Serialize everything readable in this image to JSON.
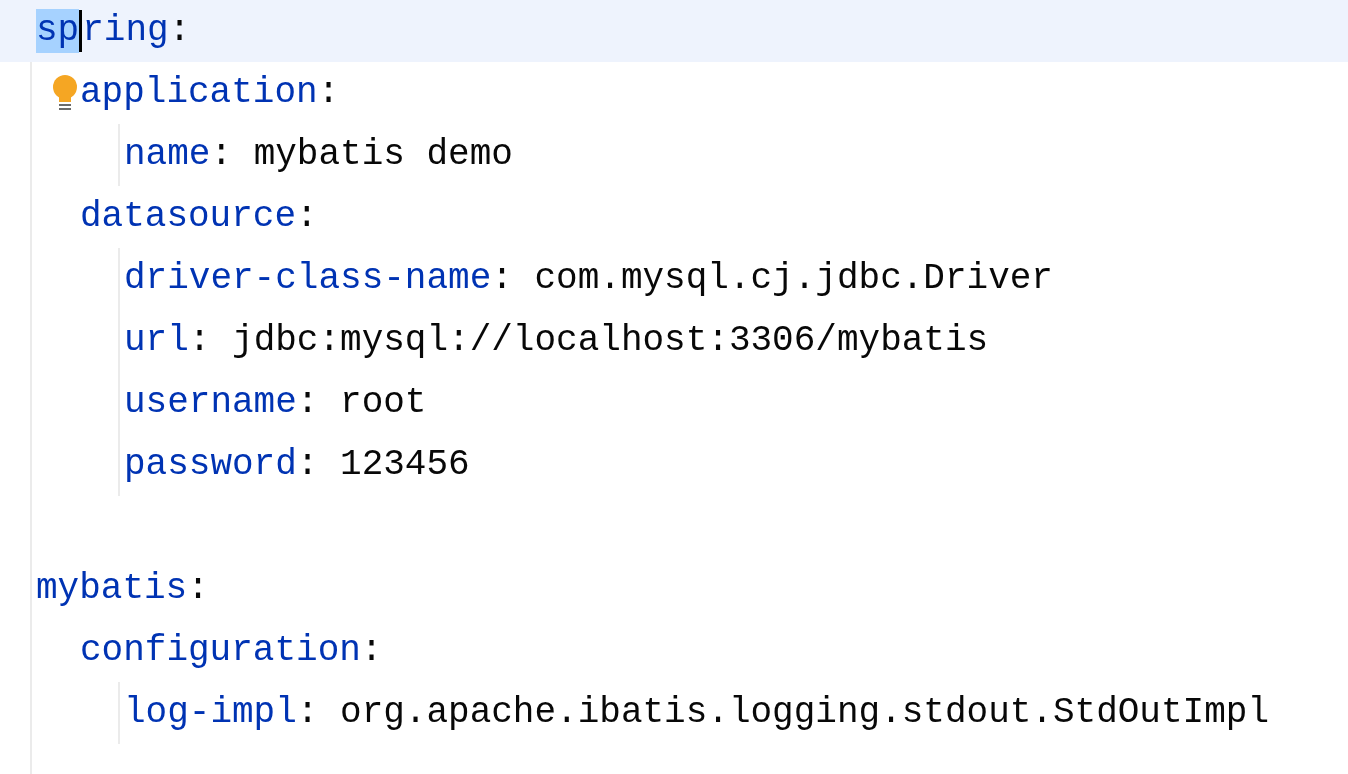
{
  "editor": {
    "lines": [
      {
        "kind": "entry",
        "current": true,
        "key_parts": [
          {
            "text": "sp",
            "selected": true
          },
          {
            "text": "ring",
            "selected": false
          }
        ],
        "colon": ":",
        "children": [
          {
            "kind": "entry",
            "hint": true,
            "key_parts": [
              {
                "text": "application",
                "selected": false
              }
            ],
            "colon": ":",
            "children": [
              {
                "kind": "entry",
                "key_parts": [
                  {
                    "text": "name",
                    "selected": false
                  }
                ],
                "colon": ":",
                "value": "mybatis demo"
              }
            ]
          },
          {
            "kind": "entry",
            "key_parts": [
              {
                "text": "datasource",
                "selected": false
              }
            ],
            "colon": ":",
            "children": [
              {
                "kind": "entry",
                "key_parts": [
                  {
                    "text": "driver-class-name",
                    "selected": false
                  }
                ],
                "colon": ":",
                "value": "com.mysql.cj.jdbc.Driver"
              },
              {
                "kind": "entry",
                "key_parts": [
                  {
                    "text": "url",
                    "selected": false
                  }
                ],
                "colon": ":",
                "value": "jdbc:mysql://localhost:3306/mybatis"
              },
              {
                "kind": "entry",
                "key_parts": [
                  {
                    "text": "username",
                    "selected": false
                  }
                ],
                "colon": ":",
                "value": "root"
              },
              {
                "kind": "entry",
                "key_parts": [
                  {
                    "text": "password",
                    "selected": false
                  }
                ],
                "colon": ":",
                "value": "123456"
              }
            ]
          }
        ]
      },
      {
        "kind": "blank"
      },
      {
        "kind": "entry",
        "key_parts": [
          {
            "text": "mybatis",
            "selected": false
          }
        ],
        "colon": ":",
        "children": [
          {
            "kind": "entry",
            "key_parts": [
              {
                "text": "configuration",
                "selected": false
              }
            ],
            "colon": ":",
            "children": [
              {
                "kind": "entry",
                "key_parts": [
                  {
                    "text": "log-impl",
                    "selected": false
                  }
                ],
                "colon": ":",
                "value": "org.apache.ibatis.logging.stdout.StdOutImpl"
              }
            ]
          }
        ]
      }
    ]
  }
}
